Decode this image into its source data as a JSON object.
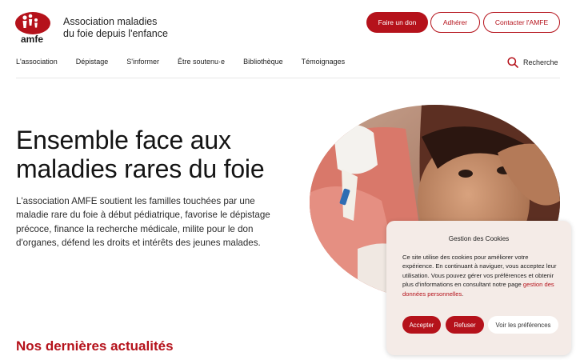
{
  "header": {
    "logo_text": "amfe",
    "org_name_line1": "Association maladies",
    "org_name_line2": "du foie depuis l'enfance",
    "buttons": {
      "donate": "Faire un don",
      "join": "Adhérer",
      "contact": "Contacter l'AMFE"
    }
  },
  "nav": {
    "items": [
      "L'association",
      "Dépistage",
      "S'informer",
      "Être soutenu·e",
      "Bibliothèque",
      "Témoignages"
    ],
    "search_label": "Recherche"
  },
  "hero": {
    "title_line1": "Ensemble face aux",
    "title_line2": "maladies rares du foie",
    "text": "L'association AMFE soutient les familles touchées par une maladie rare du foie à début pédiatrique, favorise le dépistage précoce, finance la recherche médicale, milite pour le don d'organes, défend les droits et intérêts des jeunes malades.",
    "image_icon": "child-patient-photo"
  },
  "news": {
    "title": "Nos dernières actualités"
  },
  "cookie_banner": {
    "title": "Gestion des Cookies",
    "text": "Ce site utilise des cookies pour améliorer votre expérience. En continuant à naviguer, vous acceptez leur utilisation. Vous pouvez gérer vos préférences et obtenir plus d'informations en consultant notre page",
    "link_text": "gestion des données personnelles",
    "after_link": ".",
    "accept": "Accepter",
    "refuse": "Refuser",
    "preferences": "Voir les préférences"
  },
  "colors": {
    "brand": "#b5121b",
    "cookie_bg": "#f4ebe7"
  }
}
